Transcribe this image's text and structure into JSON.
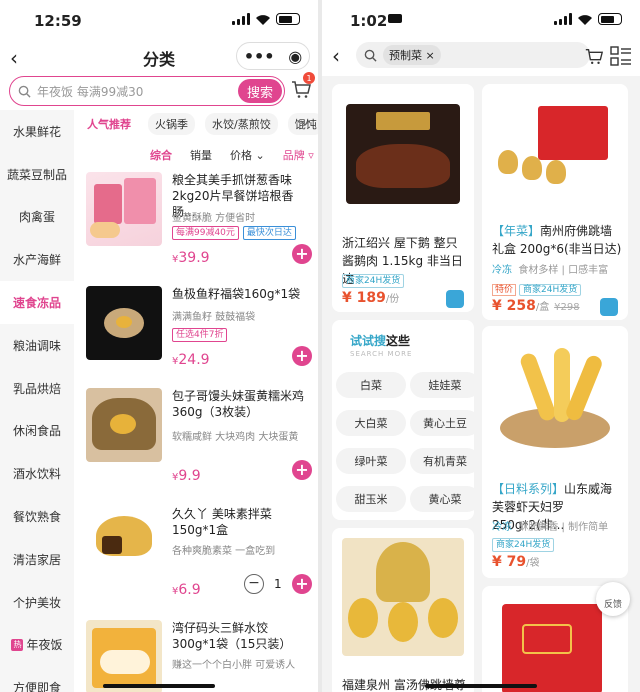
{
  "left": {
    "status": {
      "time": "12:59"
    },
    "nav": {
      "title": "分类",
      "back_icon": "chevron-left-icon"
    },
    "search": {
      "placeholder": "年夜饭 每满99减30",
      "button": "搜索",
      "cart_badge": "1"
    },
    "sidebar": [
      "水果鲜花",
      "蔬菜豆制品",
      "肉禽蛋",
      "水产海鲜",
      "速食冻品",
      "粮油调味",
      "乳品烘焙",
      "休闲食品",
      "酒水饮料",
      "餐饮熟食",
      "清洁家居",
      "个护美妆",
      "年夜饭",
      "方便即食"
    ],
    "sidebar_active": 4,
    "sidebar_hot_badge": "热",
    "tags": [
      "人气推荐",
      "火锅季",
      "水饺/蒸煎饺",
      "馄饨"
    ],
    "sort": [
      "综合",
      "销量",
      "价格",
      "品牌"
    ],
    "products": [
      {
        "title": "粮全其美手抓饼葱香味2kg20片早餐饼培根香肠...",
        "sub": "金黄酥脆 方便省时",
        "tags": [
          "每满99减40元",
          "最快次日达"
        ],
        "price": "39.9"
      },
      {
        "title": "鱼极鱼籽福袋160g*1袋",
        "sub": "满满鱼籽 鼓鼓福袋",
        "tags": [
          "任选4件7折"
        ],
        "price": "24.9"
      },
      {
        "title": "包子哥馒头妹蛋黄糯米鸡360g（3枚装）",
        "sub": "软糯咸鲜 大块鸡肉 大块蛋黄",
        "tags": [],
        "price": "9.9"
      },
      {
        "title": "久久丫 美味素拌菜150g*1盒",
        "sub": "各种爽脆素菜 一盒吃到",
        "tags": [],
        "price": "6.9",
        "qty": "1"
      },
      {
        "title": "湾仔码头三鲜水饺300g*1袋（15只装）",
        "sub": "赚这一个个白小胖 可爱诱人",
        "tags": [],
        "price": ""
      }
    ]
  },
  "right": {
    "status": {
      "time": "1:02"
    },
    "search_chip": "预制菜",
    "cards": {
      "c1": {
        "title": "浙江绍兴 屋下鹅 整只酱鹅肉 1.15kg 非当日达",
        "badge": "商家24H发货",
        "price": "189",
        "unit": "/份"
      },
      "c2": {
        "tag": "【年菜】",
        "title": "南州府佛跳墙礼盒 200g*6(非当日达)",
        "sub_tag": "冷冻",
        "sub": "食材多样 | 口感丰富",
        "badge": "商家24H发货",
        "tejia": "特价",
        "price": "258",
        "unit": "/盒",
        "orig": "¥298"
      },
      "c3": {
        "head_a": "试试搜",
        "head_b": "这些",
        "head_en": "SEARCH MORE",
        "keywords": [
          "白菜",
          "娃娃菜",
          "大白菜",
          "黄心土豆",
          "绿叶菜",
          "有机青菜",
          "甜玉米",
          "黄心菜"
        ]
      },
      "c4": {
        "tag": "【日料系列】",
        "title": "山东威海 芙蓉虾天妇罗 250g*2(非...",
        "sub_tag": "冷冻",
        "sub": "酥脆鲜香 | 制作简单",
        "badge": "商家24H发货",
        "price": "79",
        "unit": "/袋"
      },
      "c5": {
        "title": "福建泉州 富汤佛跳墙尊享"
      }
    },
    "feedback": "反馈"
  }
}
